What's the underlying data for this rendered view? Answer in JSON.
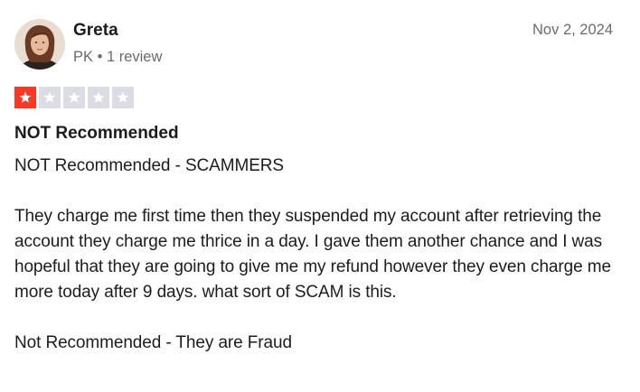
{
  "reviewer": {
    "name": "Greta",
    "meta": "PK • 1 review",
    "avatar": "reviewer-avatar-photo"
  },
  "review": {
    "date": "Nov 2, 2024",
    "rating": 1,
    "max_rating": 5,
    "title": "NOT Recommended",
    "paragraphs": [
      "NOT Recommended - SCAMMERS",
      "They charge me first time then they suspended my account after retrieving the account they charge me thrice in a day. I gave them another chance and I was hopeful that they are going to give me my refund however they even charge me more today after 9 days. what sort of SCAM is this.",
      "Not Recommended - They are Fraud"
    ]
  },
  "colors": {
    "star_active": "#ff3722",
    "star_inactive": "#dcdce6",
    "text_primary": "#1c1c1c",
    "text_secondary": "#6b6b6b"
  },
  "icons": {
    "star": "star-icon"
  }
}
